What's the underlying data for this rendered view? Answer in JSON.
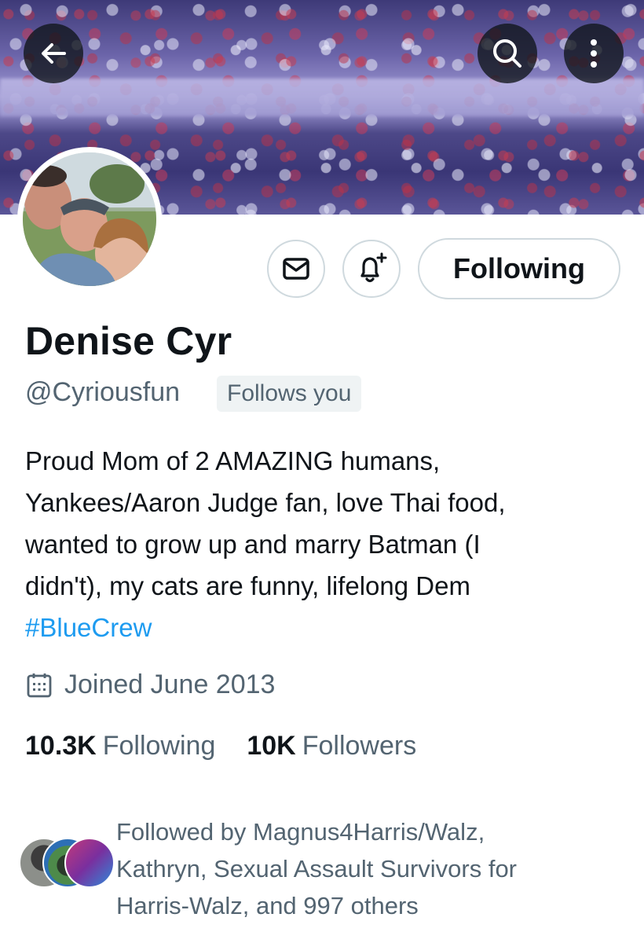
{
  "header": {
    "back_icon": "arrow-left-icon",
    "search_icon": "search-icon",
    "more_icon": "more-vertical-icon"
  },
  "actions": {
    "message_icon": "envelope-icon",
    "notify_icon": "bell-plus-icon",
    "following_label": "Following"
  },
  "profile": {
    "name": "Denise Cyr",
    "handle": "@Cyriousfun",
    "follows_you": "Follows you",
    "bio_lines": [
      "Proud Mom of 2 AMAZING humans,",
      "Yankees/Aaron Judge fan, love Thai food,",
      "wanted to grow up and marry Batman (I",
      "didn't), my cats are funny, lifelong Dem"
    ],
    "hashtag": "#BlueCrew",
    "joined": "Joined June 2013",
    "calendar_icon": "calendar-icon"
  },
  "stats": {
    "following_count": "10.3K",
    "following_label": "Following",
    "followers_count": "10K",
    "followers_label": "Followers"
  },
  "mutuals": {
    "lines": [
      "Followed by Magnus4Harris/Walz,",
      "Kathryn, Sexual Assault Survivors for",
      "Harris-Walz, and 997 others"
    ]
  },
  "colors": {
    "accent": "#1d9bf0",
    "text": "#0f1419",
    "secondary": "#536471",
    "border": "#cfd9de"
  }
}
